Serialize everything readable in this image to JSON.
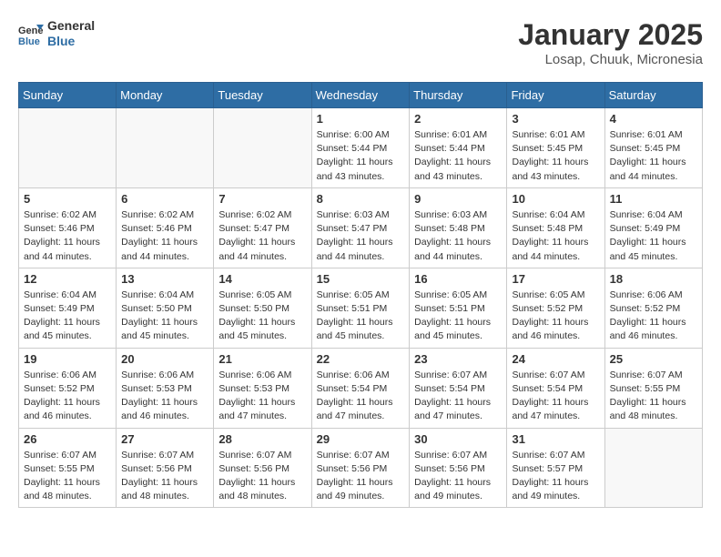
{
  "header": {
    "logo_line1": "General",
    "logo_line2": "Blue",
    "month": "January 2025",
    "location": "Losap, Chuuk, Micronesia"
  },
  "weekdays": [
    "Sunday",
    "Monday",
    "Tuesday",
    "Wednesday",
    "Thursday",
    "Friday",
    "Saturday"
  ],
  "weeks": [
    [
      {
        "day": "",
        "info": ""
      },
      {
        "day": "",
        "info": ""
      },
      {
        "day": "",
        "info": ""
      },
      {
        "day": "1",
        "info": "Sunrise: 6:00 AM\nSunset: 5:44 PM\nDaylight: 11 hours\nand 43 minutes."
      },
      {
        "day": "2",
        "info": "Sunrise: 6:01 AM\nSunset: 5:44 PM\nDaylight: 11 hours\nand 43 minutes."
      },
      {
        "day": "3",
        "info": "Sunrise: 6:01 AM\nSunset: 5:45 PM\nDaylight: 11 hours\nand 43 minutes."
      },
      {
        "day": "4",
        "info": "Sunrise: 6:01 AM\nSunset: 5:45 PM\nDaylight: 11 hours\nand 44 minutes."
      }
    ],
    [
      {
        "day": "5",
        "info": "Sunrise: 6:02 AM\nSunset: 5:46 PM\nDaylight: 11 hours\nand 44 minutes."
      },
      {
        "day": "6",
        "info": "Sunrise: 6:02 AM\nSunset: 5:46 PM\nDaylight: 11 hours\nand 44 minutes."
      },
      {
        "day": "7",
        "info": "Sunrise: 6:02 AM\nSunset: 5:47 PM\nDaylight: 11 hours\nand 44 minutes."
      },
      {
        "day": "8",
        "info": "Sunrise: 6:03 AM\nSunset: 5:47 PM\nDaylight: 11 hours\nand 44 minutes."
      },
      {
        "day": "9",
        "info": "Sunrise: 6:03 AM\nSunset: 5:48 PM\nDaylight: 11 hours\nand 44 minutes."
      },
      {
        "day": "10",
        "info": "Sunrise: 6:04 AM\nSunset: 5:48 PM\nDaylight: 11 hours\nand 44 minutes."
      },
      {
        "day": "11",
        "info": "Sunrise: 6:04 AM\nSunset: 5:49 PM\nDaylight: 11 hours\nand 45 minutes."
      }
    ],
    [
      {
        "day": "12",
        "info": "Sunrise: 6:04 AM\nSunset: 5:49 PM\nDaylight: 11 hours\nand 45 minutes."
      },
      {
        "day": "13",
        "info": "Sunrise: 6:04 AM\nSunset: 5:50 PM\nDaylight: 11 hours\nand 45 minutes."
      },
      {
        "day": "14",
        "info": "Sunrise: 6:05 AM\nSunset: 5:50 PM\nDaylight: 11 hours\nand 45 minutes."
      },
      {
        "day": "15",
        "info": "Sunrise: 6:05 AM\nSunset: 5:51 PM\nDaylight: 11 hours\nand 45 minutes."
      },
      {
        "day": "16",
        "info": "Sunrise: 6:05 AM\nSunset: 5:51 PM\nDaylight: 11 hours\nand 45 minutes."
      },
      {
        "day": "17",
        "info": "Sunrise: 6:05 AM\nSunset: 5:52 PM\nDaylight: 11 hours\nand 46 minutes."
      },
      {
        "day": "18",
        "info": "Sunrise: 6:06 AM\nSunset: 5:52 PM\nDaylight: 11 hours\nand 46 minutes."
      }
    ],
    [
      {
        "day": "19",
        "info": "Sunrise: 6:06 AM\nSunset: 5:52 PM\nDaylight: 11 hours\nand 46 minutes."
      },
      {
        "day": "20",
        "info": "Sunrise: 6:06 AM\nSunset: 5:53 PM\nDaylight: 11 hours\nand 46 minutes."
      },
      {
        "day": "21",
        "info": "Sunrise: 6:06 AM\nSunset: 5:53 PM\nDaylight: 11 hours\nand 47 minutes."
      },
      {
        "day": "22",
        "info": "Sunrise: 6:06 AM\nSunset: 5:54 PM\nDaylight: 11 hours\nand 47 minutes."
      },
      {
        "day": "23",
        "info": "Sunrise: 6:07 AM\nSunset: 5:54 PM\nDaylight: 11 hours\nand 47 minutes."
      },
      {
        "day": "24",
        "info": "Sunrise: 6:07 AM\nSunset: 5:54 PM\nDaylight: 11 hours\nand 47 minutes."
      },
      {
        "day": "25",
        "info": "Sunrise: 6:07 AM\nSunset: 5:55 PM\nDaylight: 11 hours\nand 48 minutes."
      }
    ],
    [
      {
        "day": "26",
        "info": "Sunrise: 6:07 AM\nSunset: 5:55 PM\nDaylight: 11 hours\nand 48 minutes."
      },
      {
        "day": "27",
        "info": "Sunrise: 6:07 AM\nSunset: 5:56 PM\nDaylight: 11 hours\nand 48 minutes."
      },
      {
        "day": "28",
        "info": "Sunrise: 6:07 AM\nSunset: 5:56 PM\nDaylight: 11 hours\nand 48 minutes."
      },
      {
        "day": "29",
        "info": "Sunrise: 6:07 AM\nSunset: 5:56 PM\nDaylight: 11 hours\nand 49 minutes."
      },
      {
        "day": "30",
        "info": "Sunrise: 6:07 AM\nSunset: 5:56 PM\nDaylight: 11 hours\nand 49 minutes."
      },
      {
        "day": "31",
        "info": "Sunrise: 6:07 AM\nSunset: 5:57 PM\nDaylight: 11 hours\nand 49 minutes."
      },
      {
        "day": "",
        "info": ""
      }
    ]
  ]
}
